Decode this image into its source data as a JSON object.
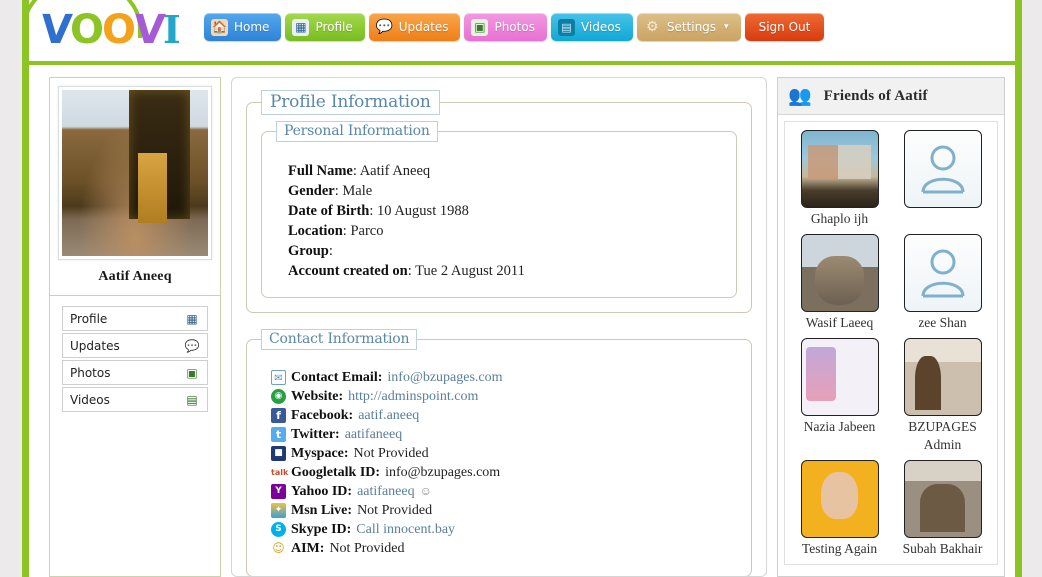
{
  "site": {
    "logo_letters": [
      "V",
      "O",
      "O",
      "V",
      "I"
    ],
    "brand_green": "#8cc424"
  },
  "nav": {
    "items": [
      {
        "label": "Home",
        "icon": "house-icon",
        "color": "#2f82d8"
      },
      {
        "label": "Profile",
        "icon": "id-card-icon",
        "color": "#79bc21"
      },
      {
        "label": "Updates",
        "icon": "chat-icon",
        "color": "#ef7f17"
      },
      {
        "label": "Photos",
        "icon": "picture-icon",
        "color": "#e970d2"
      },
      {
        "label": "Videos",
        "icon": "film-icon",
        "color": "#10a8d6"
      },
      {
        "label": "Settings",
        "icon": "gear-icon",
        "color": "#caa461",
        "caret": "▾"
      },
      {
        "label": "Sign Out",
        "icon": "",
        "color": "#d83c10"
      }
    ]
  },
  "sidebar": {
    "avatar_alt": "profile-photo",
    "user_name": "Aatif Aneeq",
    "menu": [
      {
        "label": "Profile",
        "icon": "id-card-icon"
      },
      {
        "label": "Updates",
        "icon": "chat-bubbles-icon"
      },
      {
        "label": "Photos",
        "icon": "picture-icon"
      },
      {
        "label": "Videos",
        "icon": "film-strip-icon"
      }
    ]
  },
  "main": {
    "profile_legend": "Profile Information",
    "personal_legend": "Personal Information",
    "personal": [
      {
        "label": "Full Name",
        "value": "Aatif Aneeq"
      },
      {
        "label": "Gender",
        "value": "Male"
      },
      {
        "label": "Date of Birth",
        "value": "10 August 1988"
      },
      {
        "label": "Location",
        "value": "Parco"
      },
      {
        "label": "Group",
        "value": ""
      },
      {
        "label": "Account created on",
        "value": "Tue 2 August 2011"
      }
    ],
    "contact_legend": "Contact Information",
    "contact": [
      {
        "icon": "envelope-icon",
        "label": "Contact Email:",
        "value": "info@bzupages.com",
        "link": true
      },
      {
        "icon": "globe-icon",
        "label": "Website:",
        "value": "http://adminspoint.com",
        "link": true
      },
      {
        "icon": "facebook-icon",
        "label": "Facebook:",
        "value": "aatif.aneeq",
        "link": true
      },
      {
        "icon": "twitter-icon",
        "label": "Twitter:",
        "value": "aatifaneeq",
        "link": true
      },
      {
        "icon": "myspace-icon",
        "label": "Myspace:",
        "value": "Not Provided",
        "link": false
      },
      {
        "icon": "gtalk-icon",
        "label": "Googletalk ID:",
        "value": "info@bzupages.com",
        "link": false
      },
      {
        "icon": "yahoo-icon",
        "label": "Yahoo ID:",
        "value": "aatifaneeq",
        "link": true,
        "suffix": "☺"
      },
      {
        "icon": "msn-icon",
        "label": "Msn Live:",
        "value": "Not Provided",
        "link": false
      },
      {
        "icon": "skype-icon",
        "label": "Skype ID:",
        "value": "Call innocent.bay",
        "link": true
      },
      {
        "icon": "aim-icon",
        "label": "AIM:",
        "value": "Not Provided",
        "link": false
      }
    ]
  },
  "friends": {
    "title": "Friends of Aatif",
    "header_icon": "two-people-icon",
    "items": [
      {
        "name": "Ghaplo ijh",
        "thumb": "th-ghaplo",
        "placeholder": false
      },
      {
        "name": "",
        "thumb": "th-default",
        "placeholder": true
      },
      {
        "name": "Wasif Laeeq",
        "thumb": "th-cat",
        "placeholder": false
      },
      {
        "name": "zee Shan",
        "thumb": "th-default",
        "placeholder": true
      },
      {
        "name": "Nazia Jabeen",
        "thumb": "th-nazia",
        "placeholder": false
      },
      {
        "name": "BZUPAGES Admin",
        "thumb": "th-admin",
        "placeholder": false
      },
      {
        "name": "Testing Again",
        "thumb": "th-testing",
        "placeholder": false
      },
      {
        "name": "Subah Bakhair",
        "thumb": "th-subah",
        "placeholder": false
      }
    ]
  }
}
